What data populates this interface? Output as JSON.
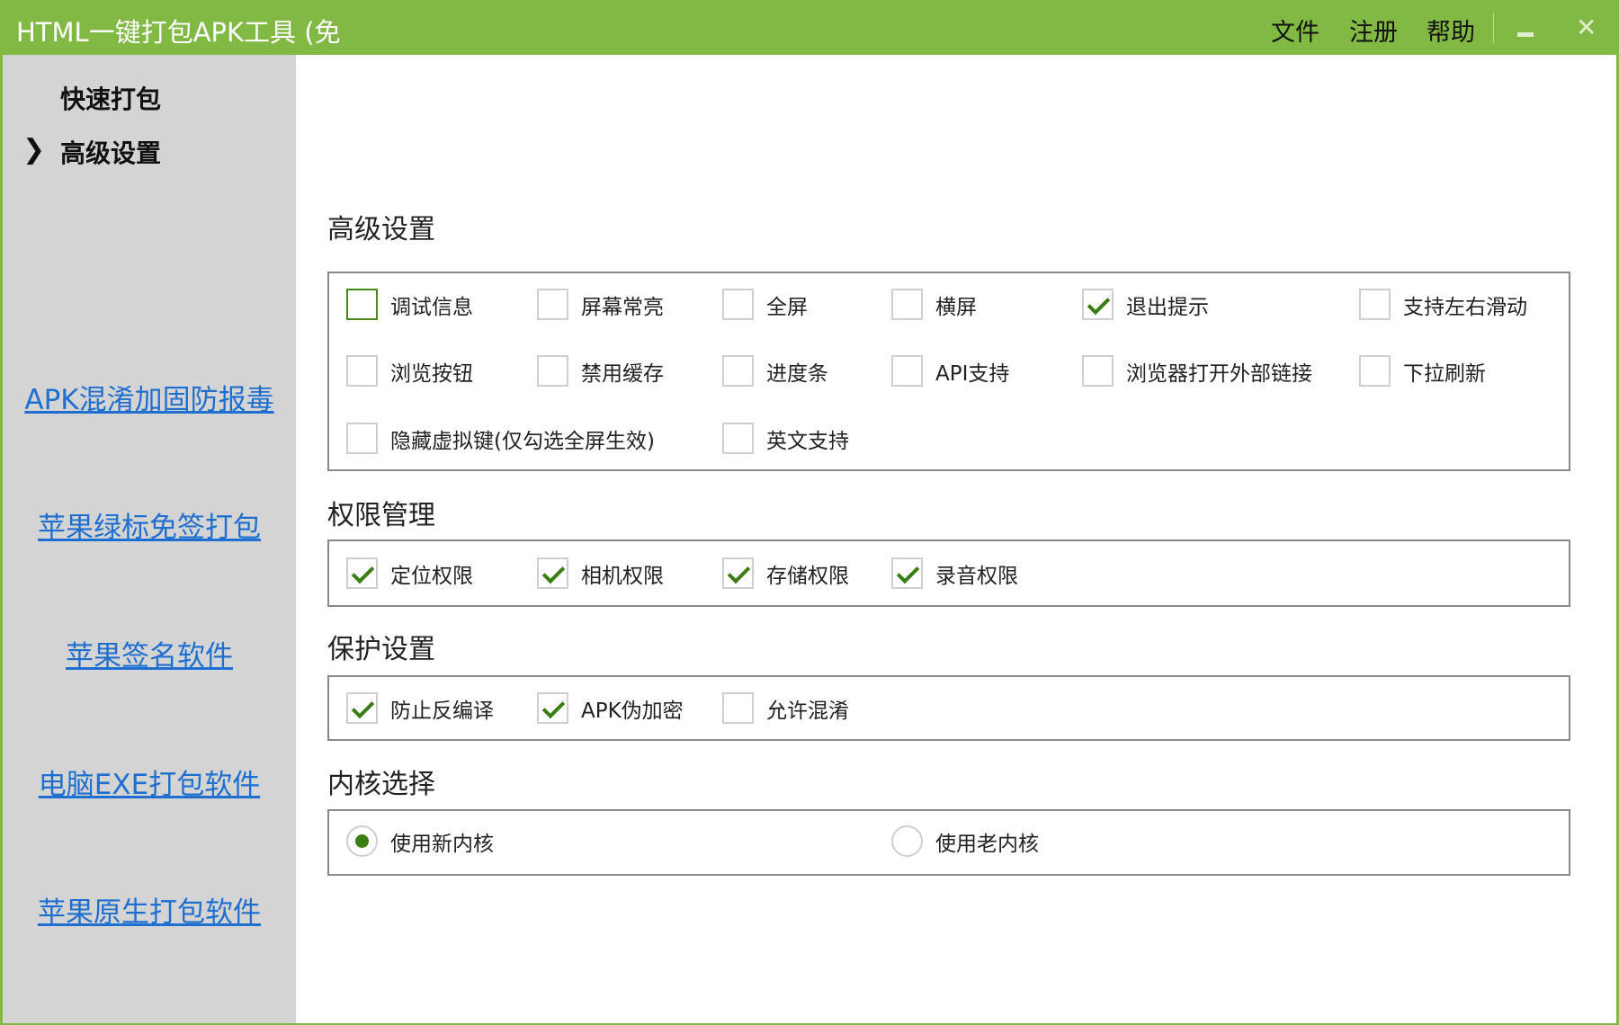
{
  "titlebar": {
    "title": "HTML一键打包APK工具 (免",
    "menu": [
      "文件",
      "注册",
      "帮助"
    ]
  },
  "sidebar": {
    "nav": [
      "快速打包",
      "高级设置"
    ],
    "active": 1,
    "links": [
      "APK混淆加固防报毒",
      "苹果绿标免签打包",
      "苹果签名软件",
      "电脑EXE打包软件",
      "苹果原生打包软件"
    ]
  },
  "advanced": {
    "title": "高级设置",
    "items": [
      {
        "label": "调试信息",
        "checked": false
      },
      {
        "label": "屏幕常亮",
        "checked": false
      },
      {
        "label": "全屏",
        "checked": false
      },
      {
        "label": "横屏",
        "checked": false
      },
      {
        "label": "退出提示",
        "checked": true
      },
      {
        "label": "支持左右滑动",
        "checked": false
      },
      {
        "label": "浏览按钮",
        "checked": false
      },
      {
        "label": "禁用缓存",
        "checked": false
      },
      {
        "label": "进度条",
        "checked": false
      },
      {
        "label": "API支持",
        "checked": false
      },
      {
        "label": "浏览器打开外部链接",
        "checked": false
      },
      {
        "label": "下拉刷新",
        "checked": false
      },
      {
        "label": "隐藏虚拟键(仅勾选全屏生效)",
        "checked": false
      },
      {
        "label": "英文支持",
        "checked": false
      }
    ]
  },
  "permissions": {
    "title": "权限管理",
    "items": [
      {
        "label": "定位权限",
        "checked": true
      },
      {
        "label": "相机权限",
        "checked": true
      },
      {
        "label": "存储权限",
        "checked": true
      },
      {
        "label": "录音权限",
        "checked": true
      }
    ]
  },
  "protection": {
    "title": "保护设置",
    "items": [
      {
        "label": "防止反编译",
        "checked": true
      },
      {
        "label": "APK伪加密",
        "checked": true
      },
      {
        "label": "允许混淆",
        "checked": false
      }
    ]
  },
  "kernel": {
    "title": "内核选择",
    "options": [
      {
        "label": "使用新内核",
        "selected": true
      },
      {
        "label": "使用老内核",
        "selected": false
      }
    ]
  },
  "colors": {
    "accent": "#81b944",
    "check": "#3a7d12",
    "link": "#1e6fcf"
  }
}
